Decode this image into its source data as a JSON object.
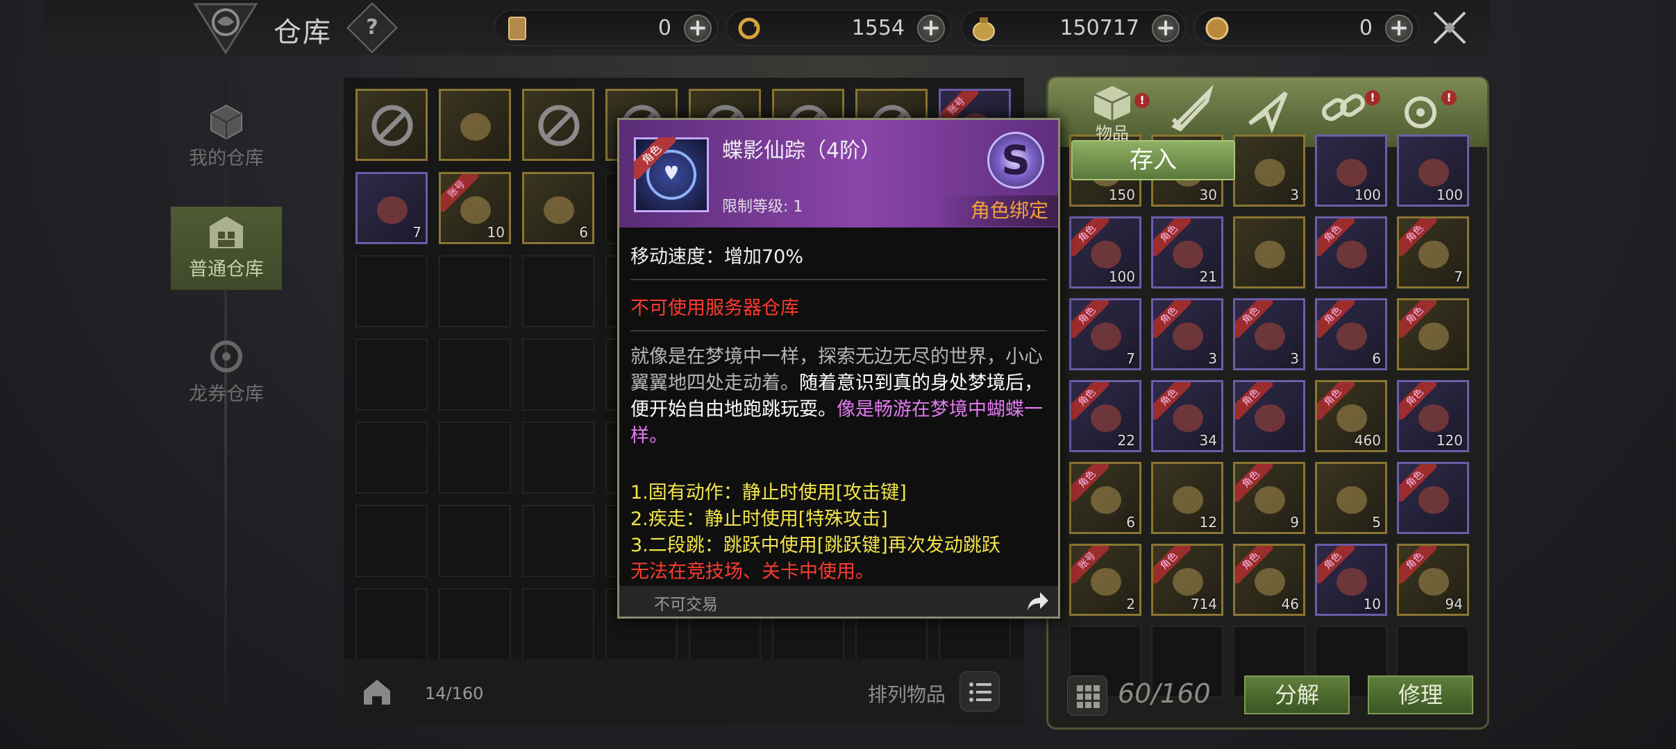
{
  "header": {
    "title": "仓库",
    "help_label": "?",
    "currencies": [
      {
        "icon": "card-icon",
        "value": "0"
      },
      {
        "icon": "cycle-coin-icon",
        "value": "1554"
      },
      {
        "icon": "gold-bag-icon",
        "value": "150717"
      },
      {
        "icon": "coin-icon",
        "value": "0"
      }
    ],
    "plus_label": "+"
  },
  "nav": {
    "items": [
      {
        "label": "我的仓库",
        "icon": "box-icon",
        "active": false
      },
      {
        "label": "普通仓库",
        "icon": "warehouse-icon",
        "active": true
      },
      {
        "label": "龙券仓库",
        "icon": "token-icon",
        "active": false
      }
    ]
  },
  "storage": {
    "capacity": "14/160",
    "sort_label": "排列物品",
    "items": [
      {
        "rarity": "gold",
        "icon": "forbidden-icon",
        "count": "",
        "tag": ""
      },
      {
        "rarity": "gold",
        "icon": "arrow-quiver-icon",
        "count": "",
        "tag": ""
      },
      {
        "rarity": "gold",
        "icon": "forbidden-icon",
        "count": "",
        "tag": ""
      },
      {
        "rarity": "gold",
        "icon": "forbidden-icon",
        "count": "",
        "tag": ""
      },
      {
        "rarity": "gold",
        "icon": "forbidden-icon",
        "count": "",
        "tag": ""
      },
      {
        "rarity": "gold",
        "icon": "forbidden-icon",
        "count": "",
        "tag": ""
      },
      {
        "rarity": "gold",
        "icon": "forbidden-icon",
        "count": "",
        "tag": ""
      },
      {
        "rarity": "purple",
        "icon": "item-icon",
        "count": "",
        "tag": "账号"
      },
      {
        "rarity": "purple",
        "icon": "horn-icon",
        "count": "7",
        "tag": ""
      },
      {
        "rarity": "gold",
        "icon": "creature-icon",
        "count": "10",
        "tag": "账号"
      },
      {
        "rarity": "gold",
        "icon": "creature-icon",
        "count": "6",
        "tag": ""
      }
    ]
  },
  "bag": {
    "tab_label": "物品",
    "deposit_label": "存入",
    "capacity": "60/160",
    "decompose_label": "分解",
    "repair_label": "修理",
    "badge": "!",
    "rows": [
      [
        {
          "r": "gold",
          "c": "150",
          "t": ""
        },
        {
          "r": "gold",
          "c": "30",
          "t": ""
        },
        {
          "r": "gold",
          "c": "3",
          "t": ""
        },
        {
          "r": "purple",
          "c": "100",
          "t": ""
        },
        {
          "r": "purple",
          "c": "100",
          "t": ""
        }
      ],
      [
        {
          "r": "purple",
          "c": "100",
          "t": "角色"
        },
        {
          "r": "purple",
          "c": "21",
          "t": "角色"
        },
        {
          "r": "gold",
          "c": "",
          "t": ""
        },
        {
          "r": "purple",
          "c": "",
          "t": "角色"
        },
        {
          "r": "gold",
          "c": "7",
          "t": "角色"
        }
      ],
      [
        {
          "r": "purple",
          "c": "7",
          "t": "角色"
        },
        {
          "r": "purple",
          "c": "3",
          "t": "角色"
        },
        {
          "r": "purple",
          "c": "3",
          "t": "角色"
        },
        {
          "r": "purple",
          "c": "6",
          "t": "角色"
        },
        {
          "r": "gold",
          "c": "",
          "t": "角色"
        }
      ],
      [
        {
          "r": "purple",
          "c": "22",
          "t": "角色"
        },
        {
          "r": "purple",
          "c": "34",
          "t": "角色"
        },
        {
          "r": "purple",
          "c": "",
          "t": "角色"
        },
        {
          "r": "gold",
          "c": "460",
          "t": "角色"
        },
        {
          "r": "purple",
          "c": "120",
          "t": "角色"
        }
      ],
      [
        {
          "r": "gold",
          "c": "6",
          "t": "角色"
        },
        {
          "r": "gold",
          "c": "12",
          "t": ""
        },
        {
          "r": "gold",
          "c": "9",
          "t": "角色"
        },
        {
          "r": "gold",
          "c": "5",
          "t": ""
        },
        {
          "r": "purple",
          "c": "",
          "t": "角色"
        }
      ],
      [
        {
          "r": "gold",
          "c": "2",
          "t": "账号"
        },
        {
          "r": "gold",
          "c": "714",
          "t": "角色"
        },
        {
          "r": "gold",
          "c": "46",
          "t": "角色"
        },
        {
          "r": "purple",
          "c": "10",
          "t": "角色"
        },
        {
          "r": "gold",
          "c": "94",
          "t": "角色"
        }
      ]
    ]
  },
  "tooltip": {
    "icon_tag": "角色",
    "name": "蝶影仙踪（4阶）",
    "level_req": "限制等级: 1",
    "rank": "S",
    "bind": "角色绑定",
    "speed": "移动速度：增加70%",
    "warning": "不可使用服务器仓库",
    "desc_gray": "就像是在梦境中一样，探索无边无尽的世界，小心翼翼地四处走动着。",
    "desc_white": "随着意识到真的身处梦境后，便开始自由地跑跳玩耍。",
    "desc_purple": "像是畅游在梦境中蝴蝶一样。",
    "skill1": "1.固有动作：静止时使用[攻击键]",
    "skill2": "2.疾走：静止时使用[特殊攻击]",
    "skill3": "3.二段跳：跳跃中使用[跳跃键]再次发动跳跃",
    "restriction": "无法在竞技场、关卡中使用。",
    "trade": "不可交易"
  },
  "colors": {
    "accent_green": "#5f7f3b",
    "gold_border": "#8a7533",
    "purple_border": "#6d5ca8",
    "warning_red": "#ff3b30",
    "skill_yellow": "#f3e54a",
    "bind_orange": "#f3a33a"
  }
}
